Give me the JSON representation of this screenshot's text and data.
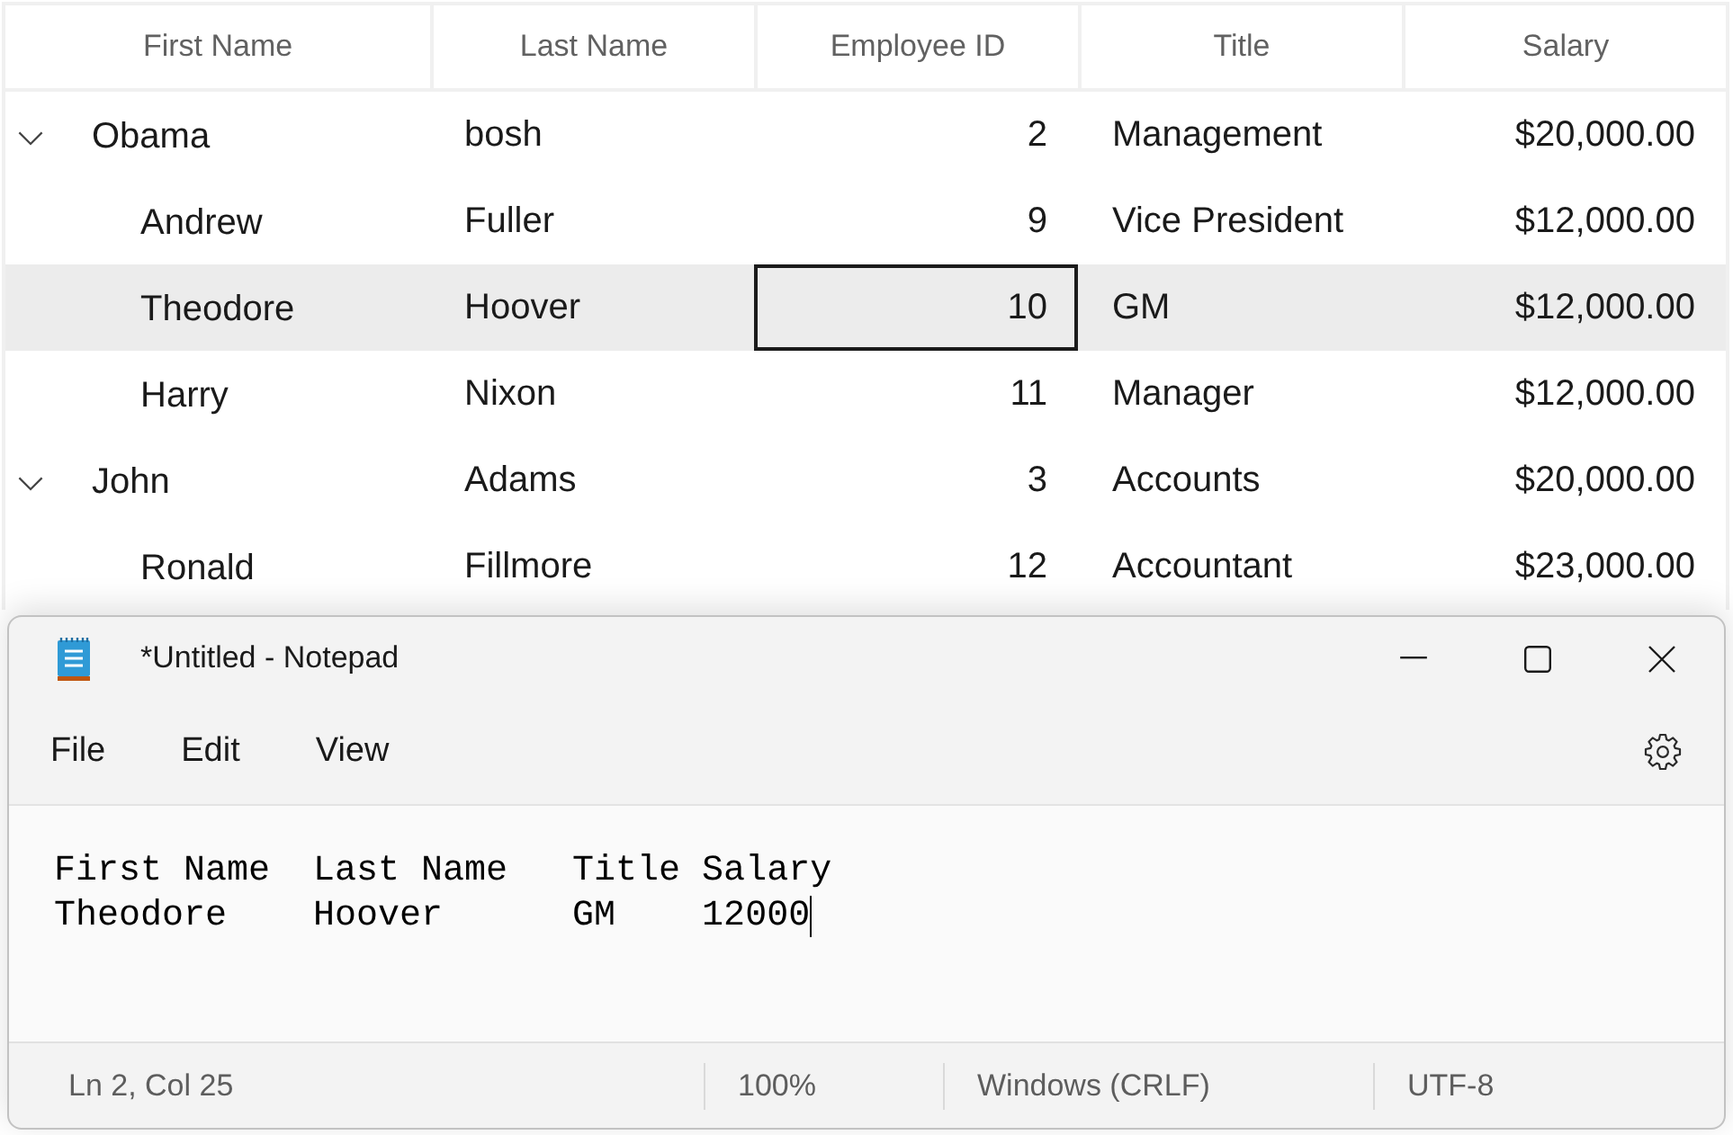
{
  "tree_grid": {
    "columns": [
      {
        "label": "First Name",
        "kind": "text"
      },
      {
        "label": "Last Name",
        "kind": "text"
      },
      {
        "label": "Employee ID",
        "kind": "number"
      },
      {
        "label": "Title",
        "kind": "text"
      },
      {
        "label": "Salary",
        "kind": "number"
      }
    ],
    "rows": [
      {
        "expanded": true,
        "selected": false,
        "cells": [
          {
            "text": "Obama",
            "focused": false
          },
          {
            "text": "bosh",
            "focused": false
          },
          {
            "text": "2",
            "focused": false
          },
          {
            "text": "Management",
            "focused": false
          },
          {
            "text": "$20,000.00",
            "focused": false
          }
        ],
        "children": [
          {
            "selected": false,
            "cells": [
              {
                "text": "Andrew",
                "focused": false
              },
              {
                "text": "Fuller",
                "focused": false
              },
              {
                "text": "9",
                "focused": false
              },
              {
                "text": "Vice President",
                "focused": false
              },
              {
                "text": "$12,000.00",
                "focused": false
              }
            ]
          },
          {
            "selected": true,
            "cells": [
              {
                "text": "Theodore",
                "focused": false
              },
              {
                "text": "Hoover",
                "focused": false
              },
              {
                "text": "10",
                "focused": true
              },
              {
                "text": "GM",
                "focused": false
              },
              {
                "text": "$12,000.00",
                "focused": false
              }
            ]
          },
          {
            "selected": false,
            "cells": [
              {
                "text": "Harry",
                "focused": false
              },
              {
                "text": "Nixon",
                "focused": false
              },
              {
                "text": "11",
                "focused": false
              },
              {
                "text": "Manager",
                "focused": false
              },
              {
                "text": "$12,000.00",
                "focused": false
              }
            ]
          }
        ]
      },
      {
        "expanded": true,
        "selected": false,
        "cells": [
          {
            "text": "John",
            "focused": false
          },
          {
            "text": "Adams",
            "focused": false
          },
          {
            "text": "3",
            "focused": false
          },
          {
            "text": "Accounts",
            "focused": false
          },
          {
            "text": "$20,000.00",
            "focused": false
          }
        ],
        "children": [
          {
            "selected": false,
            "cells": [
              {
                "text": "Ronald",
                "focused": false
              },
              {
                "text": "Fillmore",
                "focused": false
              },
              {
                "text": "12",
                "focused": false
              },
              {
                "text": "Accountant",
                "focused": false
              },
              {
                "text": "$23,000.00",
                "focused": false
              }
            ]
          }
        ]
      }
    ]
  },
  "notepad": {
    "title": "*Untitled - Notepad",
    "menu": [
      "File",
      "Edit",
      "View"
    ],
    "editor": {
      "lines": [
        {
          "text": "First Name  Last Name   Title Salary",
          "caret": false
        },
        {
          "text": "Theodore    Hoover      GM    12000",
          "caret": true
        }
      ]
    },
    "status_bar": [
      "Ln 2, Col 25",
      "100%",
      "Windows (CRLF)",
      "UTF-8"
    ]
  }
}
